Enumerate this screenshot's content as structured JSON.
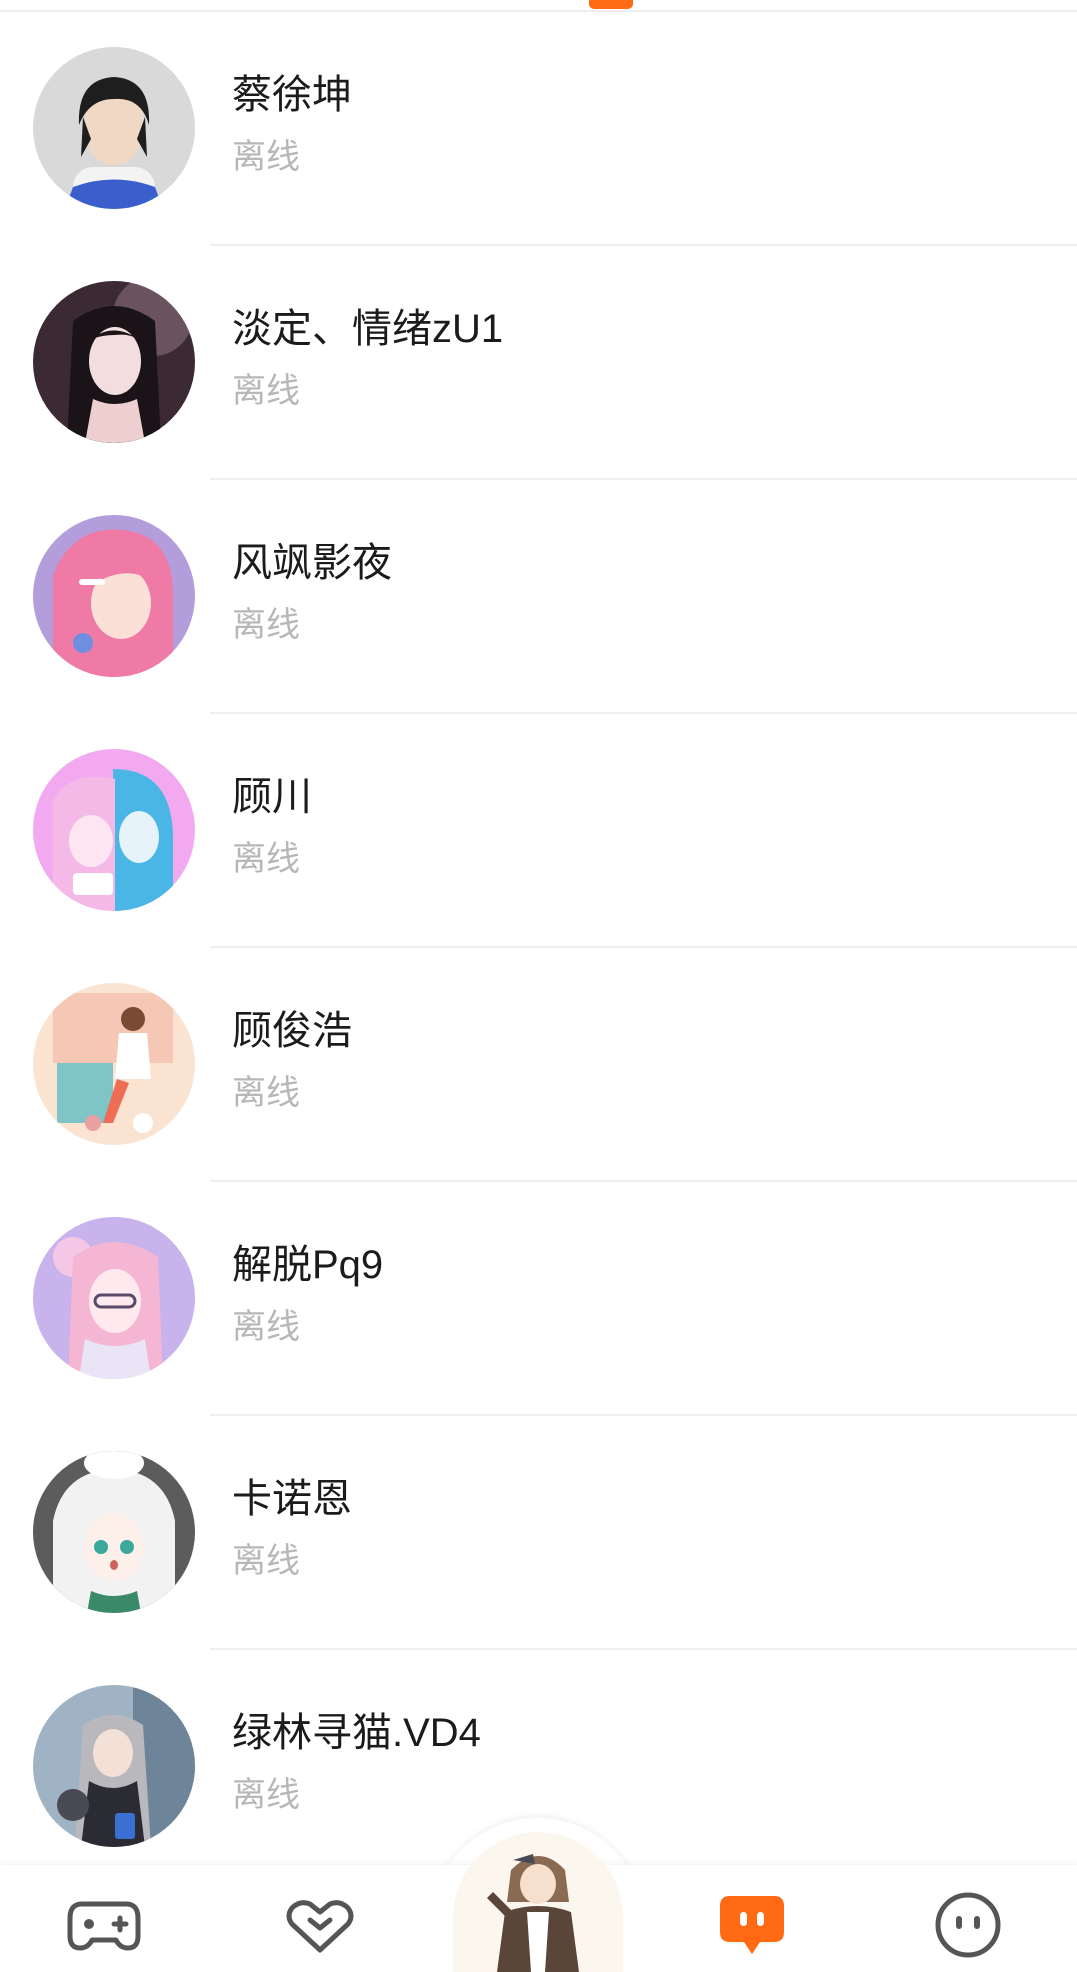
{
  "colors": {
    "accent": "#ff6a13",
    "status_text": "#b7b7b7",
    "divider": "#eeeeee",
    "nav_icon": "#555555"
  },
  "friends": [
    {
      "name": "蔡徐坤",
      "status": "离线"
    },
    {
      "name": "淡定、情绪zU1",
      "status": "离线"
    },
    {
      "name": "风飒影夜",
      "status": "离线"
    },
    {
      "name": "顾川",
      "status": "离线"
    },
    {
      "name": "顾俊浩",
      "status": "离线"
    },
    {
      "name": "解脱Pq9",
      "status": "离线"
    },
    {
      "name": "卡诺恩",
      "status": "离线"
    },
    {
      "name": "绿林寻猫.VD4",
      "status": "离线"
    }
  ],
  "bottom_nav": {
    "items": [
      {
        "icon": "gamepad-icon",
        "active": false
      },
      {
        "icon": "heart-icon",
        "active": false
      },
      {
        "icon": "character-avatar",
        "active": false
      },
      {
        "icon": "chat-bubble-icon",
        "active": true
      },
      {
        "icon": "smiley-face-icon",
        "active": false
      }
    ]
  }
}
